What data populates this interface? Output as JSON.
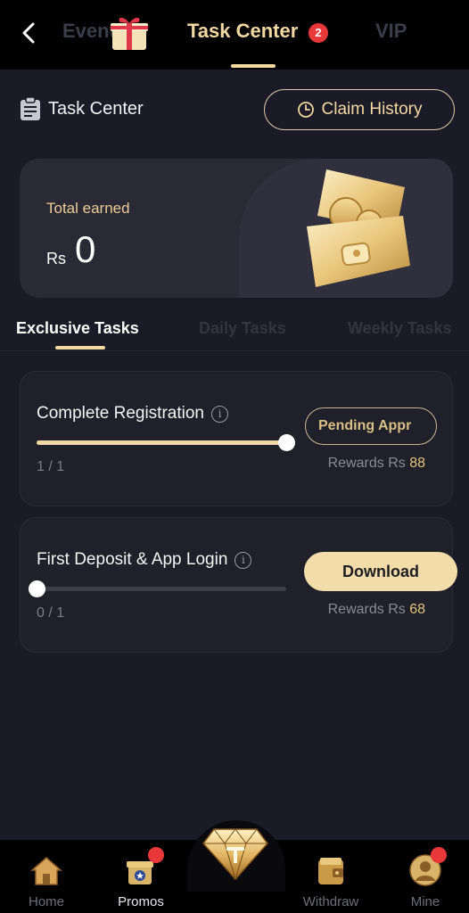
{
  "header": {
    "tabs": [
      {
        "label": "Events"
      },
      {
        "label": "Task Center"
      },
      {
        "label": "VIP"
      }
    ],
    "task_badge": "2"
  },
  "section": {
    "title": "Task Center",
    "claim_history_label": "Claim History"
  },
  "earned": {
    "label": "Total earned",
    "currency": "Rs",
    "amount": "0"
  },
  "task_tabs": [
    {
      "label": "Exclusive Tasks",
      "active": true
    },
    {
      "label": "Daily Tasks",
      "active": false
    },
    {
      "label": "Weekly Tasks",
      "active": false
    }
  ],
  "tasks": [
    {
      "title": "Complete Registration",
      "progress_text": "1 / 1",
      "progress_fraction": 1.0,
      "action_label": "Pending Appr",
      "rewards_prefix": "Rewards Rs",
      "rewards_value": "88"
    },
    {
      "title": "First Deposit & App Login",
      "progress_text": "0 / 1",
      "progress_fraction": 0.0,
      "action_label": "Download",
      "rewards_prefix": "Rewards Rs",
      "rewards_value": "68"
    }
  ],
  "bottom_nav": [
    {
      "label": "Home",
      "icon": "home-icon"
    },
    {
      "label": "Promos",
      "icon": "promos-icon",
      "active": true
    },
    {
      "label": "",
      "icon": "diamond-icon"
    },
    {
      "label": "Withdraw",
      "icon": "wallet-icon"
    },
    {
      "label": "Mine",
      "icon": "user-icon"
    }
  ],
  "colors": {
    "accent_gold": "#f3d8a2",
    "background": "#1a1b26",
    "badge_red": "#e8383a"
  }
}
